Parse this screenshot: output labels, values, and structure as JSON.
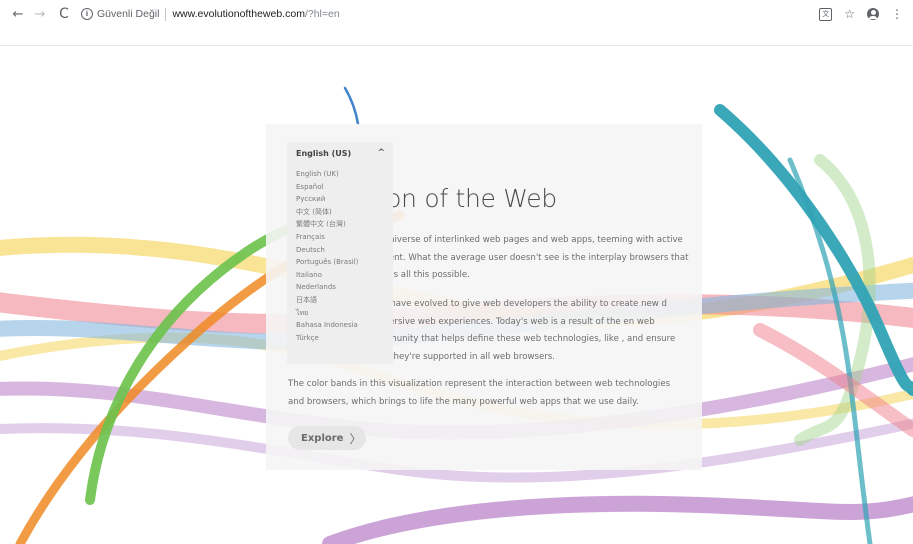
{
  "browser": {
    "back_icon": "←",
    "forward_icon": "→",
    "reload_icon": "C",
    "info_icon": "i",
    "security_label": "Güvenli Değil",
    "url_host": "www.evolutionoftheweb.com",
    "url_path": "/?hl=en",
    "translate_icon": "文",
    "star_icon": "☆",
    "menu_icon": "⋮"
  },
  "page": {
    "headline": "tion of the Web",
    "paragraph1": "ng universe of interlinked web pages and web apps, teeming with active content. What the average user doesn't see is the interplay browsers that makes all this possible.",
    "paragraph2": "gies have evolved to give web developers the ability to create new d immersive web experiences. Today's web is a result of the en web community that helps define these web technologies, like , and ensure that they're supported in all web browsers.",
    "paragraph3": "The color bands in this visualization represent the interaction between web technologies and browsers, which brings to life the many powerful web apps that we use daily.",
    "explore_label": "Explore",
    "explore_chevron": "〉"
  },
  "language_menu": {
    "selected": "English (US)",
    "caret": "^",
    "options": [
      "English (UK)",
      "Español",
      "Русский",
      "中文 (简体)",
      "繁體中文 (台灣)",
      "Français",
      "Deutsch",
      "Português (Brasil)",
      "Italiano",
      "Nederlands",
      "日本語",
      "ไทย",
      "Bahasa Indonesia",
      "Türkçe"
    ]
  },
  "colors": {
    "teal_band": "#2fa3b5",
    "green_band": "#6cc24a",
    "orange_band": "#f08a24",
    "yellow_band": "#f6d96a",
    "purple_band": "#b77cc4",
    "pink_band": "#ef7f8c",
    "blue_band": "#86b8dd"
  }
}
